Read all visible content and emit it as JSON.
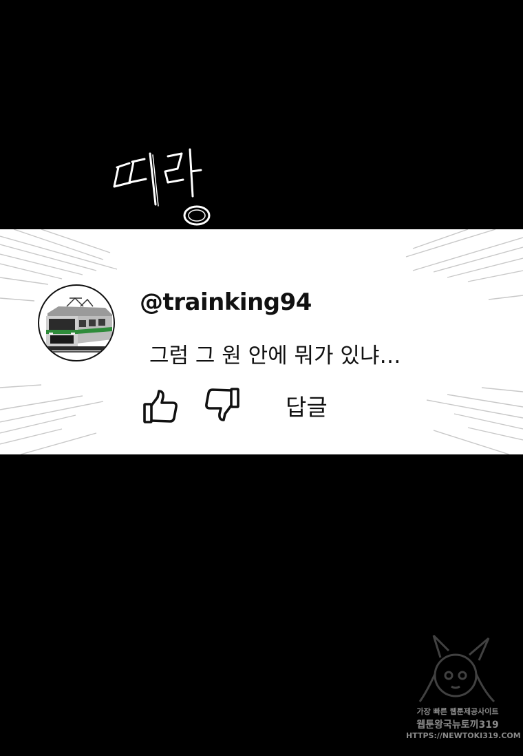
{
  "sound_effect": {
    "text": "띠링"
  },
  "comment": {
    "avatar_icon": "train-avatar-icon",
    "username": "@trainking94",
    "text": "그럼 그 원 안에 뭐가 있냐…",
    "actions": {
      "like_icon": "thumbs-up-icon",
      "dislike_icon": "thumbs-down-icon",
      "reply_label": "답글"
    }
  },
  "watermark": {
    "line1": "가장 빠른 웹툰제공사이트",
    "line2": "웹툰왕국뉴토끼319",
    "line3": "HTTPS://NEWTOKI319.COM"
  },
  "colors": {
    "background": "#000000",
    "panel": "#ffffff",
    "text": "#111111",
    "train_green": "#2e8b3a"
  }
}
